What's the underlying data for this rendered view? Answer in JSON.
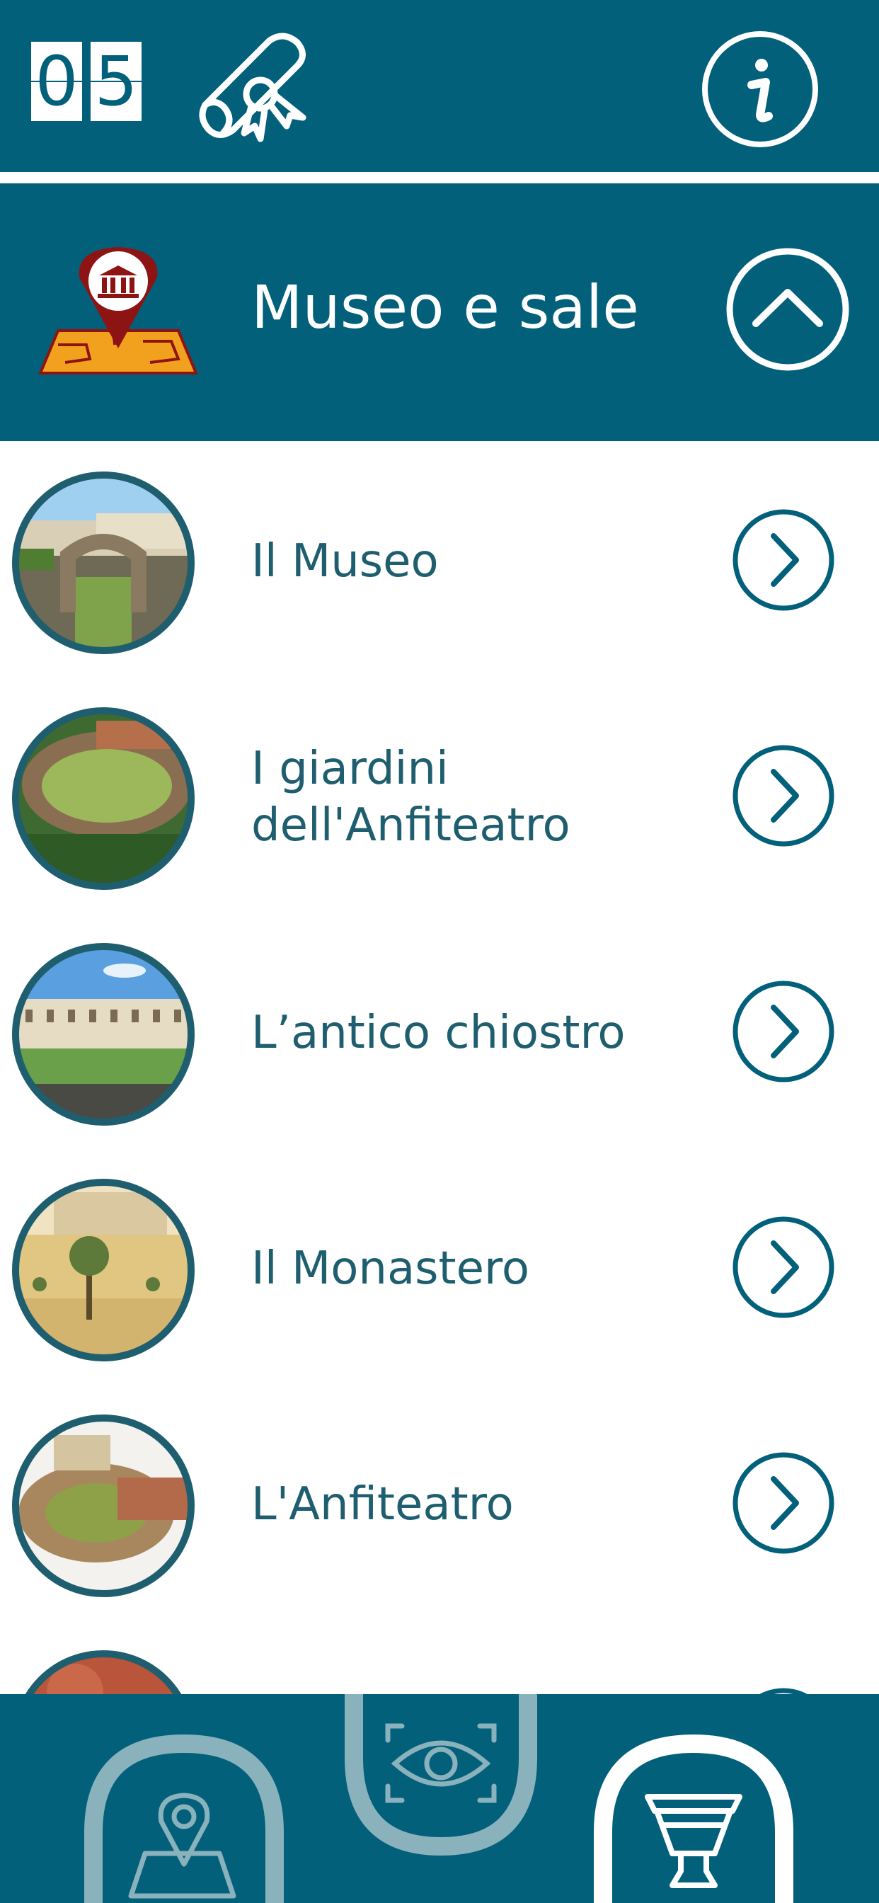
{
  "header": {
    "counter_digits": [
      "0",
      "5"
    ],
    "icons": {
      "award": "diploma-scroll-icon",
      "info": "info-icon"
    }
  },
  "section": {
    "title": "Museo e sale",
    "icon": "map-museum-pin-icon",
    "toggle_icon": "chevron-up-icon"
  },
  "list": {
    "items": [
      {
        "label": "Il Museo"
      },
      {
        "label_line1": "I giardini",
        "label_line2": "dell'Anfiteatro"
      },
      {
        "label": "L’antico chiostro"
      },
      {
        "label": "Il Monastero"
      },
      {
        "label": "L'Anfiteatro"
      }
    ]
  },
  "bottom_nav": {
    "tabs": [
      {
        "icon": "map-pin-icon"
      },
      {
        "icon": "eye-scan-icon"
      },
      {
        "icon": "vase-icon"
      }
    ]
  },
  "colors": {
    "primary": "#02607a",
    "text": "#1e5e6f",
    "pin": "#8e1414",
    "map": "#f2a11e",
    "inactive_tab": "#8ab2bd",
    "active_tab": "#ffffff"
  }
}
